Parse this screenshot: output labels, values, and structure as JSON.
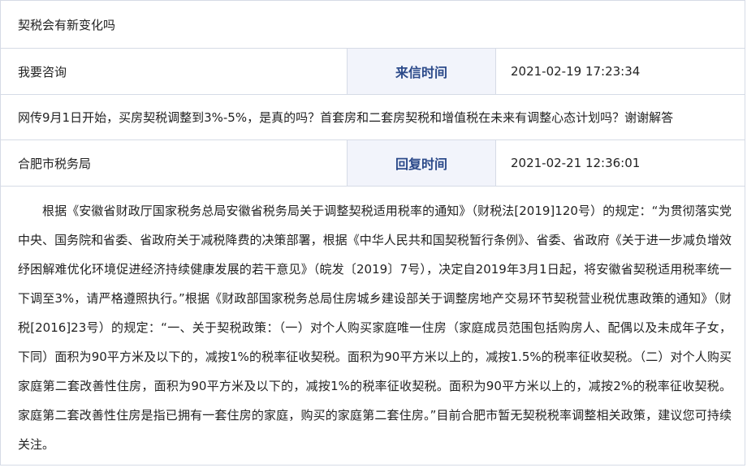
{
  "title": "契税会有新变化吗",
  "inquiry": {
    "asker": "我要咨询",
    "label": "来信时间",
    "time": "2021-02-19 17:23:34",
    "content": "网传9月1日开始，买房契税调整到3%-5%，是真的吗？首套房和二套房契税和增值税在未来有调整心态计划吗？谢谢解答"
  },
  "reply": {
    "responder": "合肥市税务局",
    "label": "回复时间",
    "time": "2021-02-21 12:36:01",
    "content": "根据《安徽省财政厅国家税务总局安徽省税务局关于调整契税适用税率的通知》（财税法[2019]120号）的规定：“为贯彻落实党中央、国务院和省委、省政府关于减税降费的决策部署，根据《中华人民共和国契税暂行条例》、省委、省政府《关于进一步减负增效纾困解难优化环境促进经济持续健康发展的若干意见》（皖发〔2019〕7号），决定自2019年3月1日起，将安徽省契税适用税率统一下调至3%，请严格遵照执行。”根据《财政部国家税务总局住房城乡建设部关于调整房地产交易环节契税营业税优惠政策的通知》（财税[2016]23号）的规定：“一、关于契税政策：（一）对个人购买家庭唯一住房（家庭成员范围包括购房人、配偶以及未成年子女，下同）面积为90平方米及以下的，减按1%的税率征收契税。面积为90平方米以上的，减按1.5%的税率征收契税。（二）对个人购买家庭第二套改善性住房，面积为90平方米及以下的，减按1%的税率征收契税。面积为90平方米以上的，减按2%的税率征收契税。家庭第二套改善性住房是指已拥有一套住房的家庭，购买的家庭第二套住房。”目前合肥市暂无契税税率调整相关政策，建议您可持续关注。"
  }
}
